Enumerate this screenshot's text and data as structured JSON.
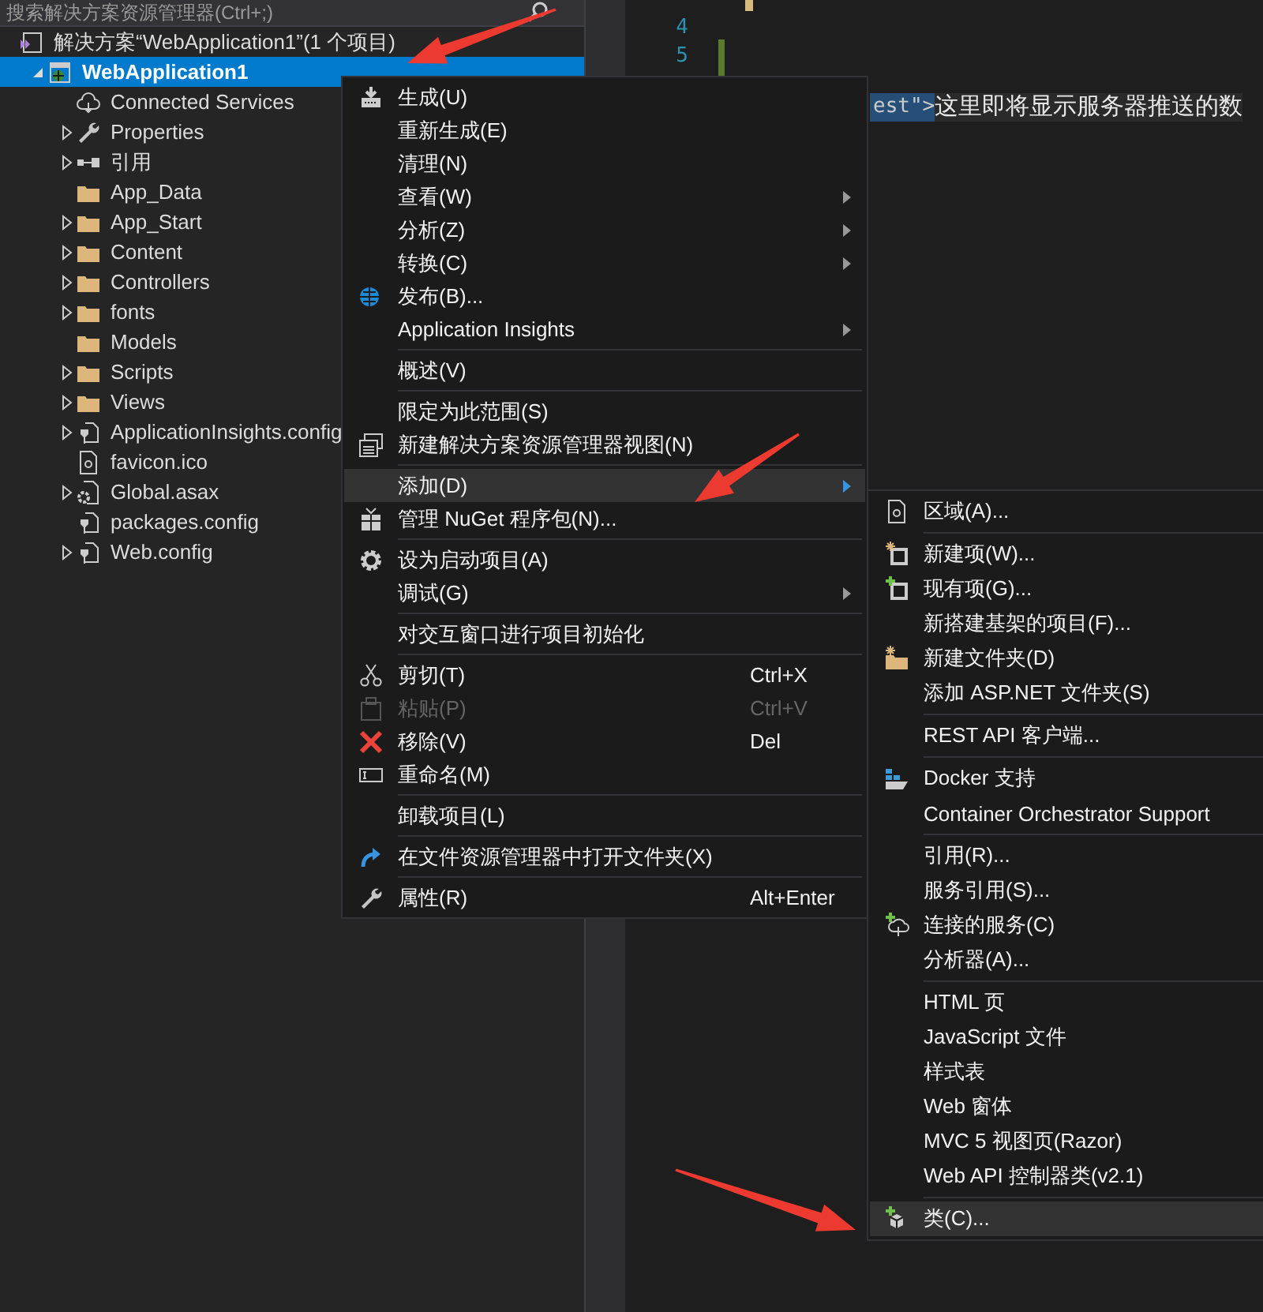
{
  "search": {
    "placeholder": "搜索解决方案资源管理器(Ctrl+;)"
  },
  "tree": [
    {
      "label": "解决方案“WebApplication1”(1 个项目)",
      "kind": "solution",
      "selected": false,
      "children": [
        {
          "label": "WebApplication1",
          "kind": "project",
          "selected": true,
          "expanded": true,
          "children": [
            {
              "label": "Connected Services",
              "kind": "cloud",
              "selected": false
            },
            {
              "label": "Properties",
              "kind": "wrench",
              "selected": false,
              "expanded": false
            },
            {
              "label": "引用",
              "kind": "reference",
              "selected": false,
              "expanded": false
            },
            {
              "label": "App_Data",
              "kind": "folder",
              "selected": false
            },
            {
              "label": "App_Start",
              "kind": "folder",
              "selected": false,
              "expanded": false
            },
            {
              "label": "Content",
              "kind": "folder",
              "selected": false,
              "expanded": false
            },
            {
              "label": "Controllers",
              "kind": "folder",
              "selected": false,
              "expanded": false
            },
            {
              "label": "fonts",
              "kind": "folder",
              "selected": false,
              "expanded": false
            },
            {
              "label": "Models",
              "kind": "folder",
              "selected": false
            },
            {
              "label": "Scripts",
              "kind": "folder",
              "selected": false,
              "expanded": false
            },
            {
              "label": "Views",
              "kind": "folder",
              "selected": false,
              "expanded": false
            },
            {
              "label": "ApplicationInsights.config",
              "kind": "config",
              "selected": false,
              "expanded": false
            },
            {
              "label": "favicon.ico",
              "kind": "file",
              "selected": false
            },
            {
              "label": "Global.asax",
              "kind": "code",
              "selected": false,
              "expanded": false
            },
            {
              "label": "packages.config",
              "kind": "config",
              "selected": false
            },
            {
              "label": "Web.config",
              "kind": "config",
              "selected": false,
              "expanded": false
            }
          ]
        }
      ]
    }
  ],
  "editor": {
    "line_numbers": [
      "4",
      "5"
    ],
    "code_selected": "est\">",
    "code_text": "这里即将显示服务器推送的数"
  },
  "context_menu": [
    {
      "kind": "build",
      "label": "生成(U)",
      "submenu": false,
      "selected": false,
      "disabled": false
    },
    {
      "kind": "plain",
      "label": "重新生成(E)",
      "submenu": false,
      "selected": false,
      "disabled": false
    },
    {
      "kind": "plain",
      "label": "清理(N)",
      "submenu": false,
      "selected": false,
      "disabled": false
    },
    {
      "kind": "plain",
      "label": "查看(W)",
      "submenu": true,
      "selected": false,
      "disabled": false
    },
    {
      "kind": "plain",
      "label": "分析(Z)",
      "submenu": true,
      "selected": false,
      "disabled": false
    },
    {
      "kind": "plain",
      "label": "转换(C)",
      "submenu": true,
      "selected": false,
      "disabled": false
    },
    {
      "kind": "globe",
      "label": "发布(B)...",
      "submenu": false,
      "selected": false,
      "disabled": false
    },
    {
      "kind": "plain",
      "label": "Application Insights",
      "submenu": true,
      "selected": false,
      "disabled": false
    },
    {
      "kind": "separator"
    },
    {
      "kind": "plain",
      "label": "概述(V)",
      "submenu": false,
      "selected": false,
      "disabled": false
    },
    {
      "kind": "separator"
    },
    {
      "kind": "plain",
      "label": "限定为此范围(S)",
      "submenu": false,
      "selected": false,
      "disabled": false
    },
    {
      "kind": "view",
      "label": "新建解决方案资源管理器视图(N)",
      "submenu": false,
      "selected": false,
      "disabled": false
    },
    {
      "kind": "separator"
    },
    {
      "kind": "plain",
      "label": "添加(D)",
      "submenu": true,
      "selected": true,
      "disabled": false
    },
    {
      "kind": "gift",
      "label": "管理 NuGet 程序包(N)...",
      "submenu": false,
      "selected": false,
      "disabled": false
    },
    {
      "kind": "separator"
    },
    {
      "kind": "gear",
      "label": "设为启动项目(A)",
      "submenu": false,
      "selected": false,
      "disabled": false
    },
    {
      "kind": "plain",
      "label": "调试(G)",
      "submenu": true,
      "selected": false,
      "disabled": false
    },
    {
      "kind": "separator"
    },
    {
      "kind": "plain",
      "label": "对交互窗口进行项目初始化",
      "submenu": false,
      "selected": false,
      "disabled": false
    },
    {
      "kind": "separator"
    },
    {
      "kind": "scissors",
      "label": "剪切(T)",
      "shortcut": "Ctrl+X",
      "submenu": false,
      "selected": false,
      "disabled": false
    },
    {
      "kind": "paste",
      "label": "粘贴(P)",
      "shortcut": "Ctrl+V",
      "submenu": false,
      "selected": false,
      "disabled": true
    },
    {
      "kind": "remove",
      "label": "移除(V)",
      "shortcut": "Del",
      "submenu": false,
      "selected": false,
      "disabled": false
    },
    {
      "kind": "rename",
      "label": "重命名(M)",
      "submenu": false,
      "selected": false,
      "disabled": false
    },
    {
      "kind": "separator"
    },
    {
      "kind": "plain",
      "label": "卸载项目(L)",
      "submenu": false,
      "selected": false,
      "disabled": false
    },
    {
      "kind": "separator"
    },
    {
      "kind": "redo",
      "label": "在文件资源管理器中打开文件夹(X)",
      "submenu": false,
      "selected": false,
      "disabled": false
    },
    {
      "kind": "separator"
    },
    {
      "kind": "wrench",
      "label": "属性(R)",
      "shortcut": "Alt+Enter",
      "submenu": false,
      "selected": false,
      "disabled": false
    }
  ],
  "add_submenu": [
    {
      "kind": "area",
      "label": "区域(A)...",
      "selected": false
    },
    {
      "kind": "separator"
    },
    {
      "kind": "new-item",
      "label": "新建项(W)...",
      "selected": false
    },
    {
      "kind": "existing-item",
      "label": "现有项(G)...",
      "selected": false
    },
    {
      "kind": "plain",
      "label": "新搭建基架的项目(F)...",
      "selected": false
    },
    {
      "kind": "new-folder",
      "label": "新建文件夹(D)",
      "selected": false
    },
    {
      "kind": "plain",
      "label": "添加 ASP.NET 文件夹(S)",
      "selected": false
    },
    {
      "kind": "separator"
    },
    {
      "kind": "plain",
      "label": "REST API 客户端...",
      "selected": false
    },
    {
      "kind": "separator"
    },
    {
      "kind": "docker",
      "label": "Docker 支持",
      "selected": false
    },
    {
      "kind": "plain",
      "label": "Container Orchestrator Support",
      "selected": false
    },
    {
      "kind": "separator"
    },
    {
      "kind": "plain",
      "label": "引用(R)...",
      "selected": false
    },
    {
      "kind": "plain",
      "label": "服务引用(S)...",
      "selected": false
    },
    {
      "kind": "connected",
      "label": "连接的服务(C)",
      "selected": false
    },
    {
      "kind": "plain",
      "label": "分析器(A)...",
      "selected": false
    },
    {
      "kind": "separator"
    },
    {
      "kind": "plain",
      "label": "HTML 页",
      "selected": false
    },
    {
      "kind": "plain",
      "label": "JavaScript 文件",
      "selected": false
    },
    {
      "kind": "plain",
      "label": "样式表",
      "selected": false
    },
    {
      "kind": "plain",
      "label": "Web 窗体",
      "selected": false
    },
    {
      "kind": "plain",
      "label": "MVC 5 视图页(Razor)",
      "selected": false
    },
    {
      "kind": "plain",
      "label": "Web API 控制器类(v2.1)",
      "selected": false
    },
    {
      "kind": "separator"
    },
    {
      "kind": "class",
      "label": "类(C)...",
      "selected": true
    }
  ]
}
